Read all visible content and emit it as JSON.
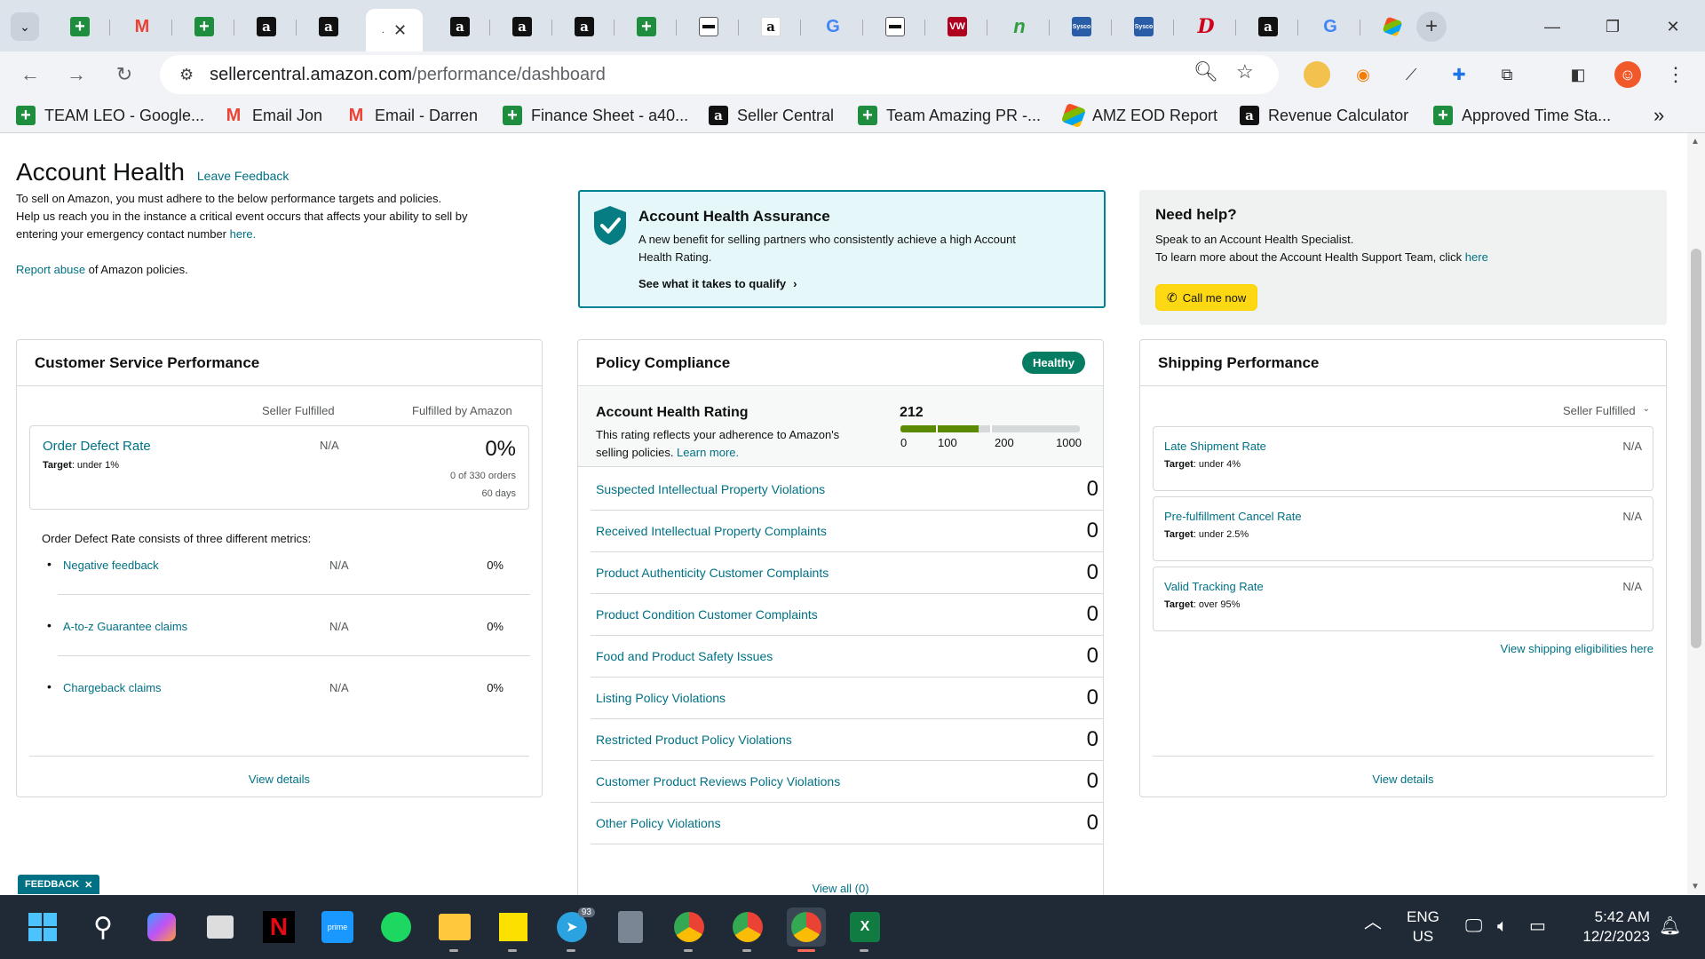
{
  "browser": {
    "url_domain": "sellercentral.amazon.com",
    "url_path": "/performance/dashboard",
    "bookmarks": [
      {
        "label": "TEAM LEO - Google...",
        "icon": "sheets-icon"
      },
      {
        "label": "Email Jon",
        "icon": "gmail-icon"
      },
      {
        "label": "Email - Darren",
        "icon": "gmail-icon"
      },
      {
        "label": "Finance Sheet - a40...",
        "icon": "sheets-icon"
      },
      {
        "label": "Seller Central",
        "icon": "amazon-icon"
      },
      {
        "label": "Team Amazing PR -...",
        "icon": "sheets-icon"
      },
      {
        "label": "AMZ EOD Report",
        "icon": "app-icon"
      },
      {
        "label": "Revenue Calculator",
        "icon": "amazon-icon"
      },
      {
        "label": "Approved Time Sta...",
        "icon": "sheets-icon"
      }
    ]
  },
  "header": {
    "title": "Account Health",
    "leave_feedback": "Leave Feedback",
    "intro_line1": "To sell on Amazon, you must adhere to the below performance targets and policies.",
    "intro_line2": "Help us reach you in the instance a critical event occurs that affects your ability to sell by",
    "intro_line3_prefix": "entering your emergency contact number ",
    "intro_line3_link": "here.",
    "report_abuse_link": "Report abuse",
    "report_abuse_suffix": " of Amazon policies."
  },
  "assurance": {
    "title": "Account Health Assurance",
    "desc_line1": "A new benefit for selling partners who consistently achieve a high Account",
    "desc_line2": "Health Rating.",
    "cta": "See what it takes to qualify"
  },
  "help": {
    "title": "Need help?",
    "line1": "Speak to an Account Health Specialist.",
    "line2_prefix": "To learn more about the Account Health Support Team, click ",
    "line2_link": "here",
    "call_button": "Call me now"
  },
  "customer_service": {
    "title": "Customer Service Performance",
    "col_seller": "Seller Fulfilled",
    "col_fba": "Fulfilled by Amazon",
    "odr_label": "Order Defect Rate",
    "odr_target_label": "Target",
    "odr_target": ": under 1%",
    "odr_seller_value": "N/A",
    "odr_fba_value": "0%",
    "odr_orders": "0 of 330 orders",
    "odr_days": "60 days",
    "consists_text": "Order Defect Rate consists of three different metrics:",
    "metrics": [
      {
        "label": "Negative feedback",
        "seller": "N/A",
        "fba": "0%"
      },
      {
        "label": "A-to-z Guarantee claims",
        "seller": "N/A",
        "fba": "0%"
      },
      {
        "label": "Chargeback claims",
        "seller": "N/A",
        "fba": "0%"
      }
    ],
    "view_details": "View details"
  },
  "policy": {
    "title": "Policy Compliance",
    "status": "Healthy",
    "ahr_title": "Account Health Rating",
    "ahr_desc1": "This rating reflects your adherence to Amazon's",
    "ahr_desc2_prefix": "selling policies. ",
    "ahr_learn_more": "Learn more.",
    "ahr_value": "212",
    "ahr_bar_fraction": 0.212,
    "ahr_ticks": [
      "0",
      "100",
      "200",
      "1000"
    ],
    "rows": [
      {
        "label": "Suspected Intellectual Property Violations",
        "value": "0"
      },
      {
        "label": "Received Intellectual Property Complaints",
        "value": "0"
      },
      {
        "label": "Product Authenticity Customer Complaints",
        "value": "0"
      },
      {
        "label": "Product Condition Customer Complaints",
        "value": "0"
      },
      {
        "label": "Food and Product Safety Issues",
        "value": "0"
      },
      {
        "label": "Listing Policy Violations",
        "value": "0"
      },
      {
        "label": "Restricted Product Policy Violations",
        "value": "0"
      },
      {
        "label": "Customer Product Reviews Policy Violations",
        "value": "0"
      },
      {
        "label": "Other Policy Violations",
        "value": "0"
      }
    ],
    "view_all": "View all (0)"
  },
  "shipping": {
    "title": "Shipping Performance",
    "filter": "Seller Fulfilled",
    "metrics": [
      {
        "label": "Late Shipment Rate",
        "target": ": under 4%",
        "value": "N/A"
      },
      {
        "label": "Pre-fulfillment Cancel Rate",
        "target": ": under 2.5%",
        "value": "N/A"
      },
      {
        "label": "Valid Tracking Rate",
        "target": ": over 95%",
        "value": "N/A"
      }
    ],
    "target_label": "Target",
    "eligibility_link": "View shipping eligibilities here",
    "view_details": "View details"
  },
  "feedback_tab": "FEEDBACK",
  "taskbar": {
    "lang": "ENG",
    "region": "US",
    "time": "5:42 AM",
    "date": "12/2/2023",
    "telegram_badge": "93"
  },
  "colors": {
    "link": "#007185",
    "healthy": "#067d62",
    "rating_green": "#5a8a00",
    "assurance_bg": "#e6f7f9",
    "assurance_border": "#008296",
    "call_button": "#ffd814"
  }
}
